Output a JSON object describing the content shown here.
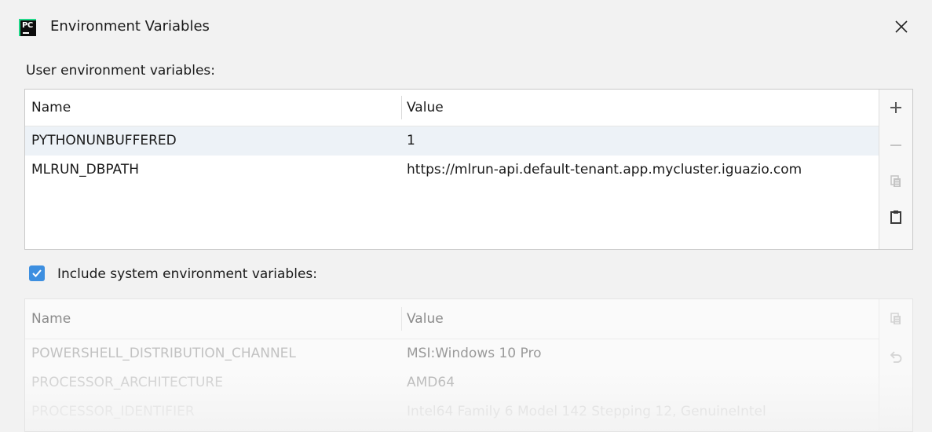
{
  "window": {
    "title": "Environment Variables",
    "icon": "pycharm-logo"
  },
  "user_section": {
    "label": "User environment variables:",
    "columns": {
      "name": "Name",
      "value": "Value"
    },
    "rows": [
      {
        "name": "PYTHONUNBUFFERED",
        "value": "1"
      },
      {
        "name": "MLRUN_DBPATH",
        "value": "https://mlrun-api.default-tenant.app.mycluster.iguazio.com"
      }
    ],
    "selected_row": 0,
    "toolbar": [
      "add-icon",
      "remove-icon",
      "copy-icon",
      "paste-icon"
    ]
  },
  "system_section": {
    "checkbox_label": "Include system environment variables:",
    "checked": true,
    "columns": {
      "name": "Name",
      "value": "Value"
    },
    "rows": [
      {
        "name": "POWERSHELL_DISTRIBUTION_CHANNEL",
        "value": "MSI:Windows 10 Pro"
      },
      {
        "name": "PROCESSOR_ARCHITECTURE",
        "value": "AMD64"
      },
      {
        "name": "PROCESSOR_IDENTIFIER",
        "value": "Intel64 Family 6 Model 142 Stepping 12, GenuineIntel"
      }
    ],
    "toolbar": [
      "copy-icon",
      "undo-icon"
    ]
  },
  "colors": {
    "accent": "#3d8fe0",
    "selected_row": "#edf2f7",
    "background": "#f2f2f2"
  }
}
